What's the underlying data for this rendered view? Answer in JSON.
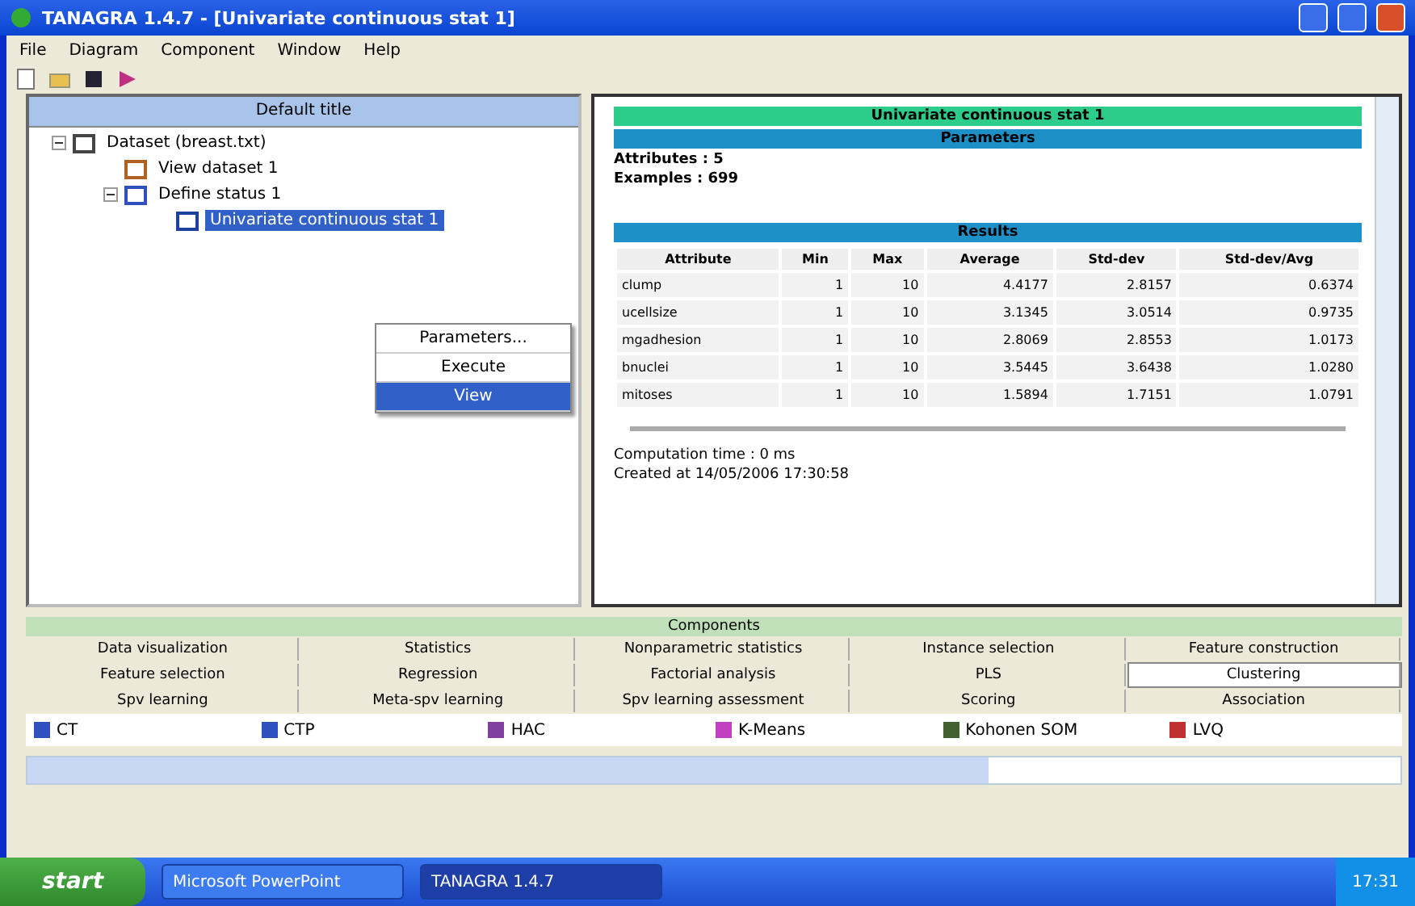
{
  "window": {
    "title": "TANAGRA 1.4.7 - [Univariate continuous stat 1]"
  },
  "menu": [
    "File",
    "Diagram",
    "Component",
    "Window",
    "Help"
  ],
  "tree": {
    "header": "Default title",
    "items": [
      {
        "label": "Dataset (breast.txt)",
        "expanded": true,
        "selected": false,
        "kind": "dataset",
        "children": [
          {
            "label": "View dataset 1",
            "selected": false,
            "kind": "view"
          },
          {
            "label": "Define status 1",
            "expanded": true,
            "selected": false,
            "kind": "status",
            "children": [
              {
                "label": "Univariate continuous stat 1",
                "selected": true,
                "kind": "stat"
              }
            ]
          }
        ]
      }
    ]
  },
  "context_menu": [
    {
      "label": "Parameters...",
      "selected": false
    },
    {
      "label": "Execute",
      "selected": false
    },
    {
      "label": "View",
      "selected": true
    }
  ],
  "report": {
    "title": "Univariate continuous stat 1",
    "parameters_header": "Parameters",
    "parameters": [
      "Attributes : 5",
      "Examples : 699"
    ],
    "results_header": "Results",
    "columns": [
      "Attribute",
      "Min",
      "Max",
      "Average",
      "Std-dev",
      "Std-dev/Avg"
    ],
    "rows": [
      [
        "clump",
        "1",
        "10",
        "4.4177",
        "2.8157",
        "0.6374"
      ],
      [
        "ucellsize",
        "1",
        "10",
        "3.1345",
        "3.0514",
        "0.9735"
      ],
      [
        "mgadhesion",
        "1",
        "10",
        "2.8069",
        "2.8553",
        "1.0173"
      ],
      [
        "bnuclei",
        "1",
        "10",
        "3.5445",
        "3.6438",
        "1.0280"
      ],
      [
        "mitoses",
        "1",
        "10",
        "1.5894",
        "1.7151",
        "1.0791"
      ]
    ],
    "footer": [
      "Computation time : 0 ms",
      "Created at 14/05/2006 17:30:58"
    ]
  },
  "components": {
    "header": "Components",
    "tabs": [
      {
        "label": "Data visualization",
        "selected": false
      },
      {
        "label": "Statistics",
        "selected": false
      },
      {
        "label": "Nonparametric statistics",
        "selected": false
      },
      {
        "label": "Instance selection",
        "selected": false
      },
      {
        "label": "Feature construction",
        "selected": false
      },
      {
        "label": "Feature selection",
        "selected": false
      },
      {
        "label": "Regression",
        "selected": false
      },
      {
        "label": "Factorial analysis",
        "selected": false
      },
      {
        "label": "PLS",
        "selected": false
      },
      {
        "label": "Clustering",
        "selected": true
      },
      {
        "label": "Spv learning",
        "selected": false
      },
      {
        "label": "Meta-spv learning",
        "selected": false
      },
      {
        "label": "Spv learning assessment",
        "selected": false
      },
      {
        "label": "Scoring",
        "selected": false
      },
      {
        "label": "Association",
        "selected": false
      }
    ],
    "items": [
      {
        "label": "CT",
        "color": "#3050c0"
      },
      {
        "label": "CTP",
        "color": "#3050c0"
      },
      {
        "label": "HAC",
        "color": "#8040a0"
      },
      {
        "label": "K-Means",
        "color": "#c040c0"
      },
      {
        "label": "Kohonen SOM",
        "color": "#406030"
      },
      {
        "label": "LVQ",
        "color": "#c03030"
      }
    ]
  },
  "taskbar": {
    "start": "start",
    "tasks": [
      {
        "label": "Microsoft PowerPoint",
        "selected": false
      },
      {
        "label": "TANAGRA 1.4.7",
        "selected": true
      }
    ],
    "clock": "17:31"
  }
}
